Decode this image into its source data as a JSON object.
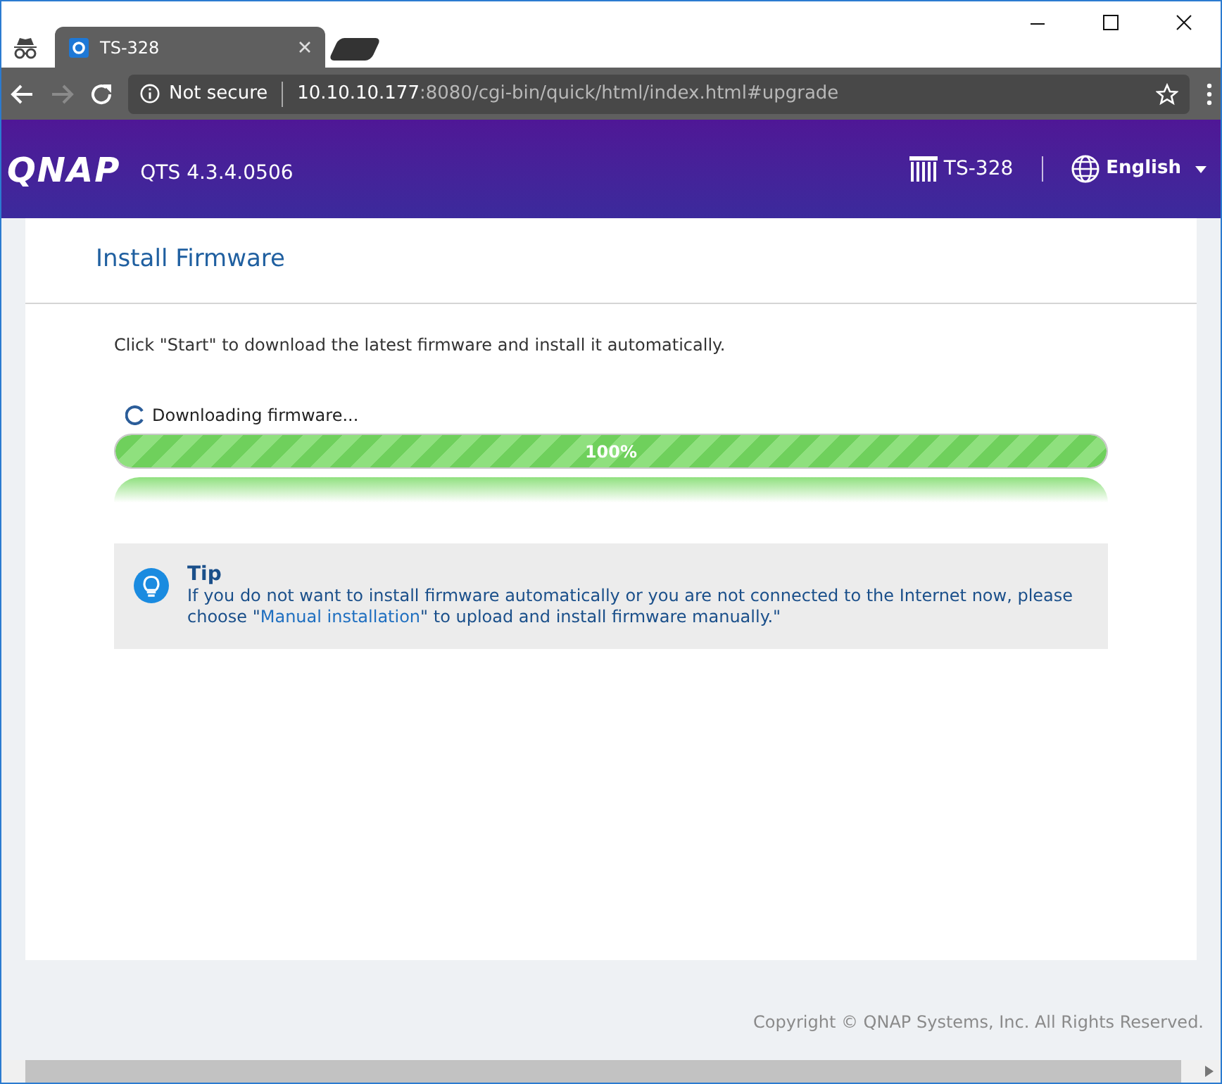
{
  "browser": {
    "tabs": [
      {
        "title": "TS-328",
        "selected": true
      }
    ],
    "not_secure": "Not secure",
    "url_host": "10.10.10.177",
    "url_rest": ":8080/cgi-bin/quick/html/index.html#upgrade"
  },
  "header": {
    "logo": "QNAP",
    "version": "QTS 4.3.4.0506",
    "device": "TS-328",
    "language": "English"
  },
  "card": {
    "title": "Install Firmware",
    "instruction": "Click \"Start\" to download the latest firmware and install it automatically.",
    "status": "Downloading firmware...",
    "progress": {
      "level": 1,
      "label": "100%"
    },
    "tip": {
      "title": "Tip",
      "before": "If you do not want to install firmware automatically or you are not connected to the Internet now, please choose \"",
      "link": "Manual installation",
      "after": "\" to upload and install firmware manually.\""
    }
  },
  "footer": {
    "copyright": "Copyright © QNAP Systems, Inc. All Rights Reserved."
  }
}
